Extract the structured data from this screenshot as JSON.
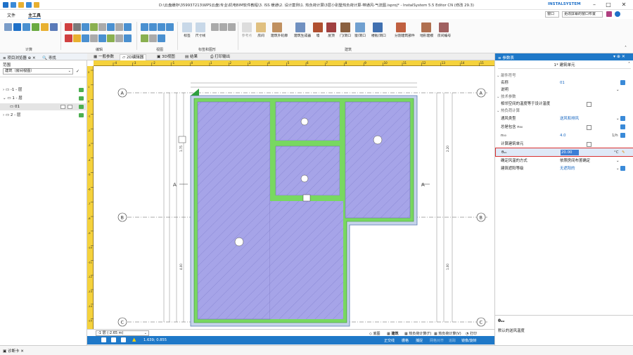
{
  "window": {
    "title": "D:\\云盘缓存\\359937213\\WPS云盘\\专业\\机电BIM软件教程\\3. ISS 暖通\\2. 设计案例\\1. 热负荷计算\\3层小别墅热负荷计算-带通风-气流图.isproj* - InstalSystem 5.5 Editor CN (修改 29.3)",
    "brand": "INSTALSYSTEM",
    "window_menu": "窗口",
    "layout_menu": "更改屏幕的窗口布置"
  },
  "menu": {
    "file": "文件",
    "home": "主工具"
  },
  "ribbon": {
    "groups": [
      "计算",
      "编辑",
      "视图",
      "标签和图形",
      "建筑"
    ],
    "tools": [
      "标签",
      "尺寸线",
      "参考点",
      "房间",
      "建筑外轮廓",
      "建筑生成器",
      "墙",
      "屋顶",
      "门/洞口",
      "窗/洞口",
      "楼板/洞口",
      "分割建筑部件",
      "地形建模",
      "房间编号"
    ]
  },
  "left": {
    "tab_browser": "项目浏览器",
    "tab_find": "寻找",
    "range_label": "范围",
    "dropdown": "建筑（房间视图）",
    "tree": [
      {
        "label": "-1 - 层",
        "indent": 0
      },
      {
        "label": "1 - 层",
        "indent": 0
      },
      {
        "label": "01",
        "indent": 1
      },
      {
        "label": "2 - 层",
        "indent": 0
      }
    ]
  },
  "canvas": {
    "tabs": [
      "一般参数",
      "2D编辑器",
      "3D视图",
      "结果",
      "打印输出"
    ],
    "ruler_x": [
      "-4",
      "-3",
      "-2",
      "-1",
      "0",
      "1",
      "2",
      "3",
      "4",
      "5",
      "6",
      "7",
      "8",
      "9",
      "10",
      "11",
      "12",
      "13",
      "14",
      "15"
    ],
    "ruler_y": [
      "2",
      "1",
      "0",
      "-1",
      "-2",
      "-3",
      "-4",
      "-5",
      "-6",
      "-7",
      "-8",
      "-9",
      "-10",
      "-11",
      "-12",
      "-13",
      "-14",
      "-15"
    ],
    "axis_labels": [
      "A",
      "B",
      "C"
    ],
    "section_labels": [
      "A",
      "A"
    ],
    "dims": [
      "1.75",
      "4.00",
      "2.20",
      "1.00"
    ],
    "floor_select": "-1 层 (-2.65 m)",
    "status_items": [
      "底图",
      "建筑",
      "热负荷计算(T)",
      "热负荷计算(V)",
      "打印"
    ],
    "coords": "1.639; 0.855",
    "bottom_items": [
      "正交线",
      "栅格",
      "捕捉",
      "网格对齐",
      "追踪",
      "镜像/旋转"
    ]
  },
  "right": {
    "panel_title": "参数表",
    "object": "1* 建筑单元",
    "sections": [
      "部件符号",
      "技术参数",
      "热负荷计算"
    ],
    "rows": [
      {
        "k": "名称",
        "v": "01"
      },
      {
        "k": "说明",
        "v": ""
      },
      {
        "k": "相邻空间的温度等于设计温度",
        "v": ""
      },
      {
        "k": "通风类型",
        "v": "送风和排风"
      },
      {
        "k": "总是包含 n₅₀",
        "v": ""
      },
      {
        "k": "n₅₀",
        "v": "4.0",
        "unit": "1/h"
      },
      {
        "k": "计算建筑单元",
        "v": ""
      },
      {
        "k": "θₛᵤ",
        "v": "20.00",
        "unit": "°C"
      },
      {
        "k": "确定风温的方式",
        "v": "依照房间布置确定"
      },
      {
        "k": "建筑遮阳等级",
        "v": "无遮阳的"
      }
    ],
    "help_symbol": "θₛᵤ",
    "help_text": "默认的送风温度"
  },
  "bottom": {
    "tab": "诊断卡"
  }
}
